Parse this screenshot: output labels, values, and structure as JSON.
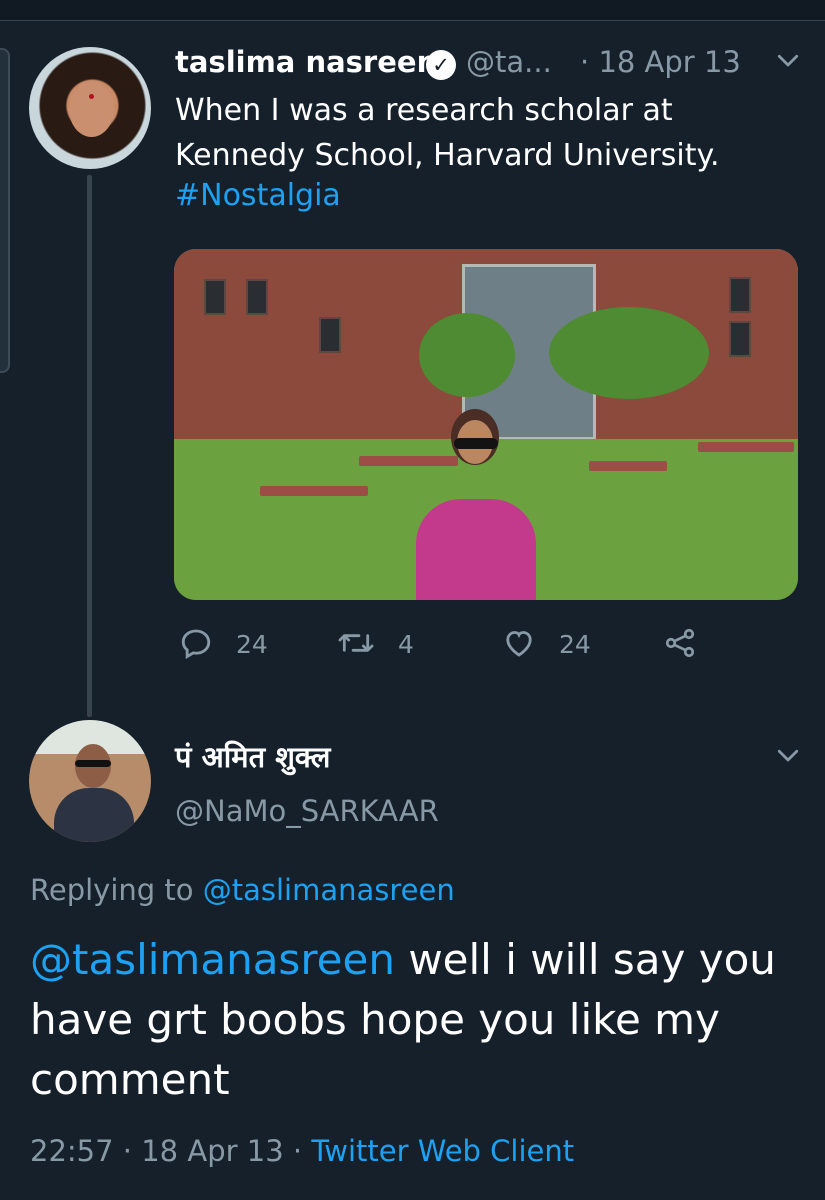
{
  "tweet": {
    "author_name": "taslima nasreen",
    "handle": "@ta...",
    "separator": "·",
    "date": "18 Apr 13",
    "text": "When I was a research scholar at Kennedy School, Harvard University.",
    "hashtag": "#Nostalgia",
    "verified": true,
    "stats": {
      "replies": "24",
      "retweets": "4",
      "likes": "24"
    }
  },
  "reply": {
    "author_name": "पं अमित शुक्ल",
    "handle": "@NaMo_SARKAAR",
    "replying_label": "Replying to ",
    "replying_to": "@taslimanasreen",
    "mention": "@taslimanasreen",
    "text": " well i will say you have grt boobs hope you like my comment",
    "time": "22:57",
    "dot": " · ",
    "date": "18 Apr 13",
    "dot2": " · ",
    "client": "Twitter Web Client"
  },
  "icons": {
    "verified": "verified-badge-icon",
    "more": "chevron-down-icon",
    "reply": "reply-icon",
    "retweet": "retweet-icon",
    "like": "heart-icon",
    "share": "share-icon"
  },
  "colors": {
    "background": "#15202b",
    "link": "#1da1f2",
    "muted": "#8899a6",
    "text": "#ffffff"
  }
}
